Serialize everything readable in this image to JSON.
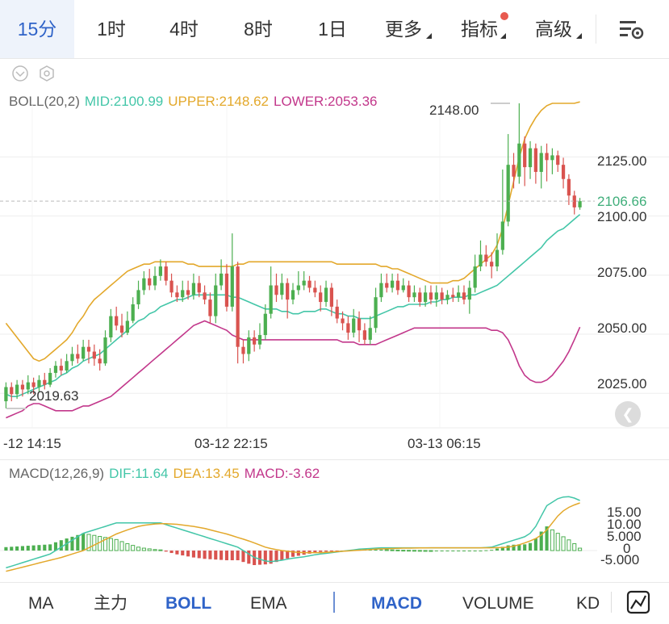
{
  "tabs": [
    {
      "label": "15分",
      "active": true
    },
    {
      "label": "1时"
    },
    {
      "label": "4时"
    },
    {
      "label": "8时"
    },
    {
      "label": "1日"
    },
    {
      "label": "更多"
    },
    {
      "label": "指标"
    },
    {
      "label": "高级"
    }
  ],
  "boll_legend": {
    "name": "BOLL(20,2)",
    "mid": "MID:2100.99",
    "upper": "UPPER:2148.62",
    "lower": "LOWER:2053.36"
  },
  "macd_legend": {
    "name": "MACD(12,26,9)",
    "dif": "DIF:11.64",
    "dea": "DEA:13.45",
    "macd": "MACD:-3.62"
  },
  "price_axis": [
    "2125.00",
    "2100.00",
    "2075.00",
    "2050.00",
    "2025.00"
  ],
  "current_price": "2106.66",
  "high_marker": "2148.00",
  "low_marker": "2019.63",
  "time_axis": [
    "-12 14:15",
    "03-12 22:15",
    "03-13 06:15"
  ],
  "macd_axis": [
    "15.00",
    "10.00",
    "5.000",
    "0",
    "-5.000"
  ],
  "bottom_tabs": [
    {
      "label": "MA"
    },
    {
      "label": "主力"
    },
    {
      "label": "BOLL",
      "active": true
    },
    {
      "label": "EMA"
    },
    {
      "label": "MACD",
      "active": true
    },
    {
      "label": "VOLUME"
    },
    {
      "label": "KD"
    }
  ],
  "colors": {
    "up": "#4caf50",
    "down": "#d9534f",
    "mid": "#43c6a8",
    "upper": "#e3a82b",
    "lower": "#c2378b",
    "accent": "#2f63c8"
  },
  "chart_data": {
    "type": "candlestick",
    "price_range": [
      2015,
      2150
    ],
    "candles": [
      [
        2022,
        2028,
        2030,
        2019
      ],
      [
        2028,
        2025,
        2030,
        2022
      ],
      [
        2025,
        2029,
        2031,
        2023
      ],
      [
        2029,
        2027,
        2031,
        2024
      ],
      [
        2027,
        2030,
        2033,
        2025
      ],
      [
        2030,
        2028,
        2032,
        2025
      ],
      [
        2028,
        2031,
        2033,
        2026
      ],
      [
        2031,
        2029,
        2034,
        2027
      ],
      [
        2029,
        2034,
        2036,
        2028
      ],
      [
        2034,
        2037,
        2039,
        2032
      ],
      [
        2037,
        2035,
        2040,
        2033
      ],
      [
        2035,
        2039,
        2042,
        2034
      ],
      [
        2039,
        2042,
        2045,
        2037
      ],
      [
        2042,
        2040,
        2046,
        2038
      ],
      [
        2040,
        2045,
        2048,
        2039
      ],
      [
        2045,
        2043,
        2048,
        2038
      ],
      [
        2043,
        2040,
        2046,
        2037
      ],
      [
        2040,
        2038,
        2044,
        2035
      ],
      [
        2038,
        2049,
        2052,
        2037
      ],
      [
        2049,
        2058,
        2061,
        2047
      ],
      [
        2058,
        2054,
        2062,
        2052
      ],
      [
        2054,
        2051,
        2059,
        2049
      ],
      [
        2051,
        2056,
        2060,
        2050
      ],
      [
        2056,
        2063,
        2066,
        2055
      ],
      [
        2063,
        2069,
        2073,
        2061
      ],
      [
        2069,
        2074,
        2077,
        2067
      ],
      [
        2074,
        2071,
        2078,
        2069
      ],
      [
        2071,
        2075,
        2079,
        2069
      ],
      [
        2075,
        2079,
        2082,
        2073
      ],
      [
        2079,
        2073,
        2081,
        2071
      ],
      [
        2073,
        2068,
        2076,
        2066
      ],
      [
        2068,
        2066,
        2071,
        2064
      ],
      [
        2066,
        2069,
        2073,
        2064
      ],
      [
        2069,
        2067,
        2073,
        2065
      ],
      [
        2067,
        2072,
        2076,
        2065
      ],
      [
        2072,
        2068,
        2075,
        2066
      ],
      [
        2068,
        2065,
        2071,
        2063
      ],
      [
        2065,
        2058,
        2068,
        2055
      ],
      [
        2058,
        2071,
        2076,
        2055
      ],
      [
        2071,
        2076,
        2082,
        2069
      ],
      [
        2076,
        2062,
        2080,
        2060
      ],
      [
        2062,
        2079,
        2093,
        2060
      ],
      [
        2079,
        2045,
        2081,
        2038
      ],
      [
        2045,
        2042,
        2048,
        2038
      ],
      [
        2042,
        2049,
        2052,
        2039
      ],
      [
        2049,
        2046,
        2052,
        2043
      ],
      [
        2046,
        2050,
        2055,
        2044
      ],
      [
        2050,
        2059,
        2063,
        2048
      ],
      [
        2059,
        2071,
        2079,
        2057
      ],
      [
        2071,
        2067,
        2076,
        2064
      ],
      [
        2067,
        2072,
        2076,
        2065
      ],
      [
        2072,
        2065,
        2074,
        2057
      ],
      [
        2065,
        2069,
        2072,
        2063
      ],
      [
        2069,
        2071,
        2077,
        2067
      ],
      [
        2071,
        2073,
        2077,
        2069
      ],
      [
        2073,
        2070,
        2075,
        2068
      ],
      [
        2070,
        2068,
        2073,
        2066
      ],
      [
        2068,
        2064,
        2071,
        2060
      ],
      [
        2064,
        2070,
        2073,
        2062
      ],
      [
        2070,
        2062,
        2072,
        2058
      ],
      [
        2062,
        2057,
        2065,
        2055
      ],
      [
        2057,
        2055,
        2060,
        2052
      ],
      [
        2055,
        2051,
        2058,
        2048
      ],
      [
        2051,
        2057,
        2061,
        2049
      ],
      [
        2057,
        2052,
        2060,
        2047
      ],
      [
        2052,
        2048,
        2055,
        2046
      ],
      [
        2048,
        2053,
        2058,
        2046
      ],
      [
        2053,
        2066,
        2070,
        2051
      ],
      [
        2066,
        2072,
        2076,
        2064
      ],
      [
        2072,
        2070,
        2076,
        2068
      ],
      [
        2070,
        2073,
        2076,
        2068
      ],
      [
        2073,
        2069,
        2076,
        2067
      ],
      [
        2069,
        2071,
        2074,
        2068
      ],
      [
        2071,
        2066,
        2073,
        2064
      ],
      [
        2066,
        2068,
        2071,
        2064
      ],
      [
        2068,
        2064,
        2070,
        2062
      ],
      [
        2064,
        2068,
        2071,
        2062
      ],
      [
        2068,
        2065,
        2071,
        2063
      ],
      [
        2065,
        2068,
        2071,
        2062
      ],
      [
        2068,
        2065,
        2070,
        2063
      ],
      [
        2065,
        2067,
        2069,
        2063
      ],
      [
        2067,
        2066,
        2070,
        2064
      ],
      [
        2066,
        2068,
        2071,
        2064
      ],
      [
        2068,
        2065,
        2071,
        2063
      ],
      [
        2065,
        2070,
        2073,
        2059
      ],
      [
        2070,
        2079,
        2084,
        2068
      ],
      [
        2079,
        2084,
        2090,
        2077
      ],
      [
        2084,
        2081,
        2088,
        2079
      ],
      [
        2081,
        2079,
        2085,
        2074
      ],
      [
        2079,
        2086,
        2093,
        2077
      ],
      [
        2086,
        2098,
        2120,
        2084
      ],
      [
        2098,
        2122,
        2135,
        2096
      ],
      [
        2122,
        2117,
        2127,
        2112
      ],
      [
        2117,
        2131,
        2148,
        2114
      ],
      [
        2131,
        2121,
        2134,
        2113
      ],
      [
        2121,
        2129,
        2132,
        2116
      ],
      [
        2129,
        2119,
        2131,
        2114
      ],
      [
        2119,
        2127,
        2130,
        2112
      ],
      [
        2127,
        2124,
        2131,
        2115
      ],
      [
        2124,
        2126,
        2129,
        2118
      ],
      [
        2126,
        2122,
        2128,
        2119
      ],
      [
        2122,
        2116,
        2125,
        2112
      ],
      [
        2116,
        2109,
        2118,
        2105
      ],
      [
        2109,
        2104,
        2111,
        2101
      ],
      [
        2104,
        2106.66,
        2108,
        2103
      ]
    ],
    "boll_mid": [
      2025,
      2024,
      2024,
      2025,
      2026,
      2027,
      2028,
      2029,
      2030,
      2031,
      2033,
      2034,
      2036,
      2037,
      2039,
      2040,
      2041,
      2042,
      2044,
      2046,
      2048,
      2050,
      2052,
      2054,
      2056,
      2057,
      2059,
      2060,
      2062,
      2063,
      2064,
      2065,
      2065,
      2066,
      2067,
      2067,
      2067,
      2067,
      2067,
      2067,
      2067,
      2066,
      2066,
      2065,
      2064,
      2063,
      2062,
      2061,
      2061,
      2061,
      2060,
      2060,
      2059,
      2059,
      2060,
      2060,
      2060,
      2061,
      2061,
      2060,
      2059,
      2059,
      2058,
      2058,
      2057,
      2057,
      2057,
      2058,
      2059,
      2060,
      2061,
      2062,
      2062,
      2063,
      2063,
      2063,
      2063,
      2064,
      2064,
      2065,
      2065,
      2066,
      2066,
      2066,
      2067,
      2067,
      2068,
      2069,
      2070,
      2071,
      2073,
      2075,
      2077,
      2079,
      2081,
      2083,
      2085,
      2087,
      2090,
      2092,
      2094,
      2095,
      2097,
      2099,
      2100.99
    ],
    "boll_upper": [
      2055,
      2052,
      2049,
      2046,
      2043,
      2040,
      2039,
      2040,
      2042,
      2044,
      2046,
      2048,
      2051,
      2055,
      2058,
      2062,
      2065,
      2067,
      2069,
      2071,
      2073,
      2075,
      2077,
      2078,
      2079,
      2080,
      2080,
      2081,
      2081,
      2081,
      2081,
      2081,
      2081,
      2080,
      2080,
      2079,
      2079,
      2079,
      2079,
      2079,
      2079,
      2079,
      2080,
      2080,
      2081,
      2081,
      2081,
      2081,
      2081,
      2081,
      2081,
      2081,
      2081,
      2081,
      2081,
      2081,
      2081,
      2081,
      2081,
      2081,
      2080,
      2080,
      2080,
      2080,
      2080,
      2080,
      2080,
      2080,
      2079,
      2079,
      2078,
      2078,
      2077,
      2076,
      2075,
      2074,
      2073,
      2072,
      2072,
      2072,
      2072,
      2073,
      2073,
      2074,
      2076,
      2078,
      2080,
      2082,
      2084,
      2088,
      2095,
      2105,
      2115,
      2125,
      2133,
      2138,
      2142,
      2145,
      2147,
      2148,
      2148,
      2148,
      2148,
      2148,
      2148.62
    ],
    "boll_lower": [
      2015,
      2016,
      2017,
      2018,
      2020,
      2021,
      2021,
      2020,
      2019,
      2018,
      2018,
      2018,
      2018,
      2019,
      2020,
      2020,
      2021,
      2022,
      2023,
      2024,
      2026,
      2028,
      2030,
      2032,
      2034,
      2036,
      2038,
      2040,
      2042,
      2044,
      2046,
      2048,
      2050,
      2052,
      2054,
      2055,
      2056,
      2055,
      2054,
      2053,
      2052,
      2050,
      2049,
      2048,
      2048,
      2048,
      2048,
      2048,
      2048,
      2048,
      2048,
      2048,
      2048,
      2048,
      2048,
      2048,
      2048,
      2048,
      2048,
      2048,
      2048,
      2047,
      2047,
      2047,
      2046,
      2046,
      2046,
      2046,
      2047,
      2048,
      2049,
      2050,
      2051,
      2052,
      2053,
      2053,
      2053,
      2053,
      2053,
      2053,
      2053,
      2053,
      2053,
      2053,
      2053,
      2053,
      2053,
      2053,
      2052,
      2052,
      2051,
      2048,
      2043,
      2037,
      2033,
      2031,
      2030,
      2030,
      2031,
      2033,
      2036,
      2039,
      2043,
      2048,
      2053.36
    ],
    "macd": {
      "range": [
        -7,
        18
      ],
      "dif": [
        -5,
        -4.5,
        -4,
        -3.5,
        -3,
        -2.5,
        -2,
        -1.5,
        -1,
        0,
        1,
        2,
        3,
        4,
        5,
        5.5,
        6,
        6.5,
        7,
        7.5,
        8,
        8,
        8,
        8,
        8,
        8,
        8,
        8,
        8,
        7.5,
        7,
        6.5,
        6,
        5.5,
        5,
        4.5,
        4,
        3.5,
        3,
        2.5,
        2,
        1.5,
        1,
        0,
        -1,
        -2,
        -2.5,
        -3,
        -3.2,
        -3,
        -2.8,
        -2.5,
        -2.2,
        -2,
        -1.8,
        -1.5,
        -1.2,
        -1,
        -0.8,
        -0.6,
        -0.4,
        -0.2,
        0,
        0.2,
        0.4,
        0.5,
        0.6,
        0.7,
        0.8,
        0.8,
        0.8,
        0.8,
        0.8,
        0.8,
        0.8,
        0.8,
        0.8,
        0.8,
        0.8,
        0.8,
        0.8,
        0.8,
        0.8,
        0.8,
        0.8,
        0.8,
        0.8,
        0.9,
        1,
        1.5,
        2,
        2.5,
        3,
        3.5,
        4,
        5,
        7,
        10,
        13,
        14,
        15,
        15.5,
        15.6,
        15.2,
        14.5,
        13.8,
        13,
        12.3,
        11.64
      ],
      "dea": [
        -6,
        -5.6,
        -5.2,
        -4.8,
        -4.4,
        -4,
        -3.6,
        -3.2,
        -2.8,
        -2.4,
        -2,
        -1.5,
        -1,
        -0.5,
        0,
        0.8,
        1.6,
        2.4,
        3.2,
        4,
        4.8,
        5.4,
        6,
        6.5,
        7,
        7.3,
        7.5,
        7.7,
        7.8,
        7.8,
        7.7,
        7.6,
        7.4,
        7.2,
        7,
        6.7,
        6.4,
        6,
        5.6,
        5.2,
        4.8,
        4.3,
        3.8,
        3.3,
        2.8,
        2.2,
        1.6,
        1,
        0.6,
        0.3,
        0,
        -0.2,
        -0.4,
        -0.5,
        -0.6,
        -0.6,
        -0.6,
        -0.6,
        -0.5,
        -0.4,
        -0.3,
        -0.2,
        -0.1,
        0,
        0.1,
        0.2,
        0.3,
        0.4,
        0.5,
        0.55,
        0.6,
        0.65,
        0.7,
        0.72,
        0.74,
        0.76,
        0.78,
        0.8,
        0.8,
        0.8,
        0.8,
        0.8,
        0.8,
        0.8,
        0.8,
        0.8,
        0.8,
        0.8,
        0.8,
        0.85,
        0.9,
        1,
        1.3,
        1.7,
        2.2,
        2.8,
        3.5,
        4.5,
        6,
        8,
        10,
        11.5,
        12.5,
        13.2,
        13.8,
        14,
        14.1,
        14,
        13.8,
        13.6,
        13.45
      ],
      "hist": [
        1,
        1.1,
        1.2,
        1.3,
        1.4,
        1.5,
        1.6,
        1.7,
        1.8,
        2.4,
        3,
        3.5,
        4,
        4.5,
        5,
        4.7,
        4.4,
        4.1,
        3.8,
        3.5,
        3.2,
        2.6,
        2,
        1.5,
        1,
        0.7,
        0.5,
        0.3,
        0.2,
        -0.3,
        -0.7,
        -1.1,
        -1.4,
        -1.7,
        -2,
        -2.2,
        -2.4,
        -2.5,
        -2.6,
        -2.7,
        -2.8,
        -2.8,
        -2.8,
        -3.3,
        -3.8,
        -4.2,
        -4.1,
        -4,
        -3.8,
        -3.3,
        -2.8,
        -2.3,
        -1.8,
        -1.5,
        -1.2,
        -0.9,
        -0.6,
        -0.4,
        -0.3,
        -0.2,
        -0.1,
        0,
        0.1,
        0.2,
        0.3,
        0.3,
        0.3,
        0.3,
        0.3,
        0.25,
        0.2,
        0.15,
        0.1,
        0.08,
        0.06,
        0.04,
        0.02,
        0,
        0,
        0,
        0,
        0,
        0,
        0,
        0,
        0,
        0,
        0.1,
        0.2,
        0.6,
        1.1,
        1.5,
        1.7,
        1.8,
        1.8,
        2.2,
        3.5,
        5.5,
        7,
        6,
        5,
        4,
        3.1,
        2,
        0.7,
        -0.2,
        -0.8,
        -1.3,
        -1.8
      ]
    }
  }
}
